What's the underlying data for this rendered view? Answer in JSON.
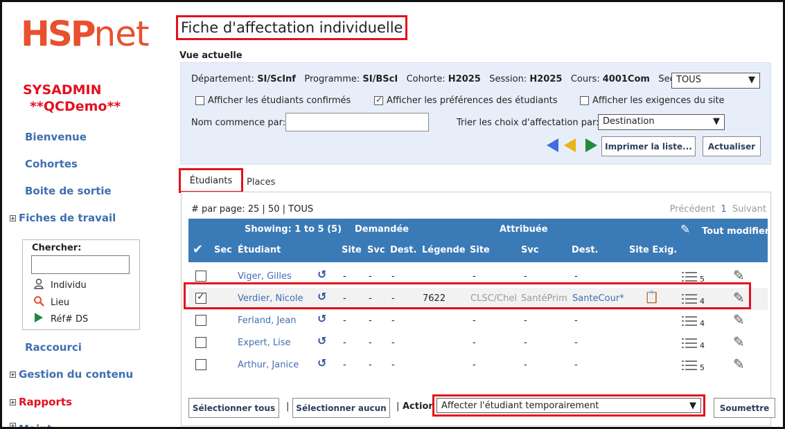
{
  "brand": {
    "logo_hsp": "HSP",
    "logo_net": "net"
  },
  "user": {
    "name": "SYSADMIN",
    "instance": "**QCDemo**"
  },
  "sidebar": {
    "links": [
      "Bienvenue",
      "Cohortes",
      "Boite de sortie"
    ],
    "fiches": "Fiches de travail",
    "search": {
      "label": "Chercher",
      "options": [
        "Individu",
        "Lieu",
        "Réf# DS"
      ]
    },
    "raccourci": "Raccourci",
    "gestion": "Gestion du contenu",
    "rapports": "Rapports",
    "cut": "Maint"
  },
  "page": {
    "title": "Fiche d'affectation individuelle",
    "vue_actuelle": "Vue actuelle"
  },
  "filters": {
    "departement_label": "Département:",
    "departement": "SI/ScInf",
    "programme_label": "Programme:",
    "programme": "SI/BScI",
    "cohorte_label": "Cohorte:",
    "cohorte": "H2025",
    "session_label": "Session:",
    "session": "H2025",
    "cours_label": "Cours:",
    "cours": "4001Com",
    "section_label": "Section:",
    "section": "TOUS",
    "chk_confirmes": "Afficher les étudiants confirmés",
    "chk_preferences": "Afficher les préférences des étudiants",
    "chk_exigences": "Afficher les exigences du site",
    "nom_label": "Nom commence par:",
    "nom_value": "",
    "trier_label": "Trier les choix d'affectation par:",
    "trier_value": "Destination",
    "imprimer": "Imprimer la liste...",
    "actualiser": "Actualiser"
  },
  "tabs": {
    "etudiants": "Étudiants",
    "places": "Places"
  },
  "pagination": {
    "label": "# par page:",
    "opt1": "25",
    "sep1": "|",
    "opt2": "50",
    "sep2": "|",
    "opt3": "TOUS",
    "prev": "Précédent",
    "current": "1",
    "next": "Suivant"
  },
  "table": {
    "showing": "Showing: 1 to 5 (5)",
    "demandee": "Demandée",
    "attribuee": "Attribuée",
    "tout_modifier": "Tout modifier",
    "cols": {
      "sec": "Sec",
      "etudiant": "Étudiant",
      "site": "Site",
      "svc": "Svc",
      "dest": "Dest.",
      "legende": "Légende",
      "site2": "Site",
      "svc2": "Svc",
      "dest2": "Dest.",
      "site_exig": "Site Exig."
    },
    "rows": [
      {
        "name": "Viger, Gilles",
        "d_site": "-",
        "d_svc": "-",
        "d_dest": "-",
        "legende": "",
        "a_site": "-",
        "a_svc": "-",
        "a_dest": "-",
        "count": "5",
        "checked": false
      },
      {
        "name": "Verdier, Nicole",
        "d_site": "-",
        "d_svc": "-",
        "d_dest": "-",
        "legende": "7622",
        "a_site": "CLSC/Chel",
        "a_svc": "SantéPrim",
        "a_dest": "SanteCour*",
        "count": "4",
        "checked": true
      },
      {
        "name": "Ferland, Jean",
        "d_site": "-",
        "d_svc": "-",
        "d_dest": "-",
        "legende": "",
        "a_site": "-",
        "a_svc": "-",
        "a_dest": "-",
        "count": "4",
        "checked": false
      },
      {
        "name": "Expert, Lise",
        "d_site": "-",
        "d_svc": "-",
        "d_dest": "-",
        "legende": "",
        "a_site": "-",
        "a_svc": "-",
        "a_dest": "-",
        "count": "4",
        "checked": false
      },
      {
        "name": "Arthur, Janice",
        "d_site": "-",
        "d_svc": "-",
        "d_dest": "-",
        "legende": "",
        "a_site": "-",
        "a_svc": "-",
        "a_dest": "-",
        "count": "5",
        "checked": false
      }
    ]
  },
  "footer": {
    "select_all": "Sélectionner tous",
    "sep": "|",
    "select_none": "Sélectionner aucun",
    "action_label": "Action",
    "action_value": "Affecter l'étudiant temporairement",
    "submit": "Soumettre"
  },
  "colors": {
    "accent_red": "#e3101e",
    "link_blue": "#3f6fb0",
    "header_blue": "#3a7ab7",
    "filter_bg": "#e8eef9"
  }
}
